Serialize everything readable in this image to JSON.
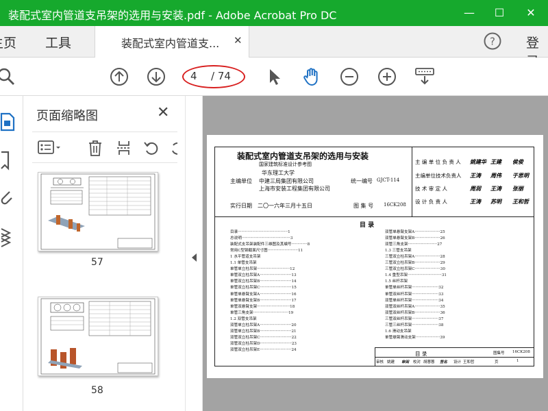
{
  "window": {
    "title": "装配式室内管道支吊架的选用与安装.pdf - Adobe Acrobat Pro DC",
    "minimize_glyph": "—",
    "maximize_glyph": "☐",
    "close_glyph": "✕"
  },
  "tabs": {
    "home": "主页",
    "tools": "工具",
    "document": "装配式室内管道支...",
    "close_glyph": "✕",
    "login": "登录"
  },
  "toolbar": {
    "current_page": "4",
    "total_pages": "/ 74",
    "accent_color": "#1e71c4",
    "icons": [
      "search-icon",
      "page-up-icon",
      "page-down-icon",
      "select-cursor-icon",
      "hand-tool-icon",
      "zoom-out-icon",
      "zoom-in-icon",
      "keyboard-nav-icon"
    ]
  },
  "thumbnail_panel": {
    "title": "页面缩略图",
    "close_glyph": "✕",
    "thumbnails": [
      {
        "label": "57"
      },
      {
        "label": "58"
      }
    ]
  },
  "document": {
    "cover": {
      "title": "装配式室内管道支吊架的选用与安装",
      "subtitle": "国家建筑标准设计参考图",
      "org_first": "华东理工大学",
      "main_unit_label": "主编单位",
      "main_unit_2": "中建三局集团有限公司",
      "main_unit_3": "上海市安装工程集团有限公司",
      "serial_label": "统一编号",
      "serial_no": "GJCT-114",
      "effective_label": "实行日期",
      "effective_date": "二〇一六年三月十五日",
      "atlas_label": "图 集 号",
      "atlas_no": "16CK208",
      "sign_rows": [
        {
          "role": "主 编 单 位 负 责 人",
          "sig1": "姚建华",
          "sig2": "王建",
          "sig3": "侯俊"
        },
        {
          "role": "主编单位技术负责人",
          "sig1": "王涛",
          "sig2": "周伟",
          "sig3": "于思明"
        },
        {
          "role": "技 术 审 定 人",
          "sig1": "周润",
          "sig2": "王涛",
          "sig3": "张丽"
        },
        {
          "role": "设 计 负 责 人",
          "sig1": "王涛",
          "sig2": "苏明",
          "sig3": "王和哲"
        }
      ]
    },
    "toc_title": "目 录",
    "toc_left": [
      "目录·········································1",
      "总说明········································3",
      "装配式支吊架装配件三维图及其编号·············8",
      "常用C型钢截面尺寸图·························11",
      "1   水平管道支吊架",
      "  1.1  单管支吊架",
      "       单管单立柱吊架···························12",
      "       单管双立柱吊架A··························13",
      "       单管双立柱吊架B··························14",
      "       单管双立柱吊架C··························15",
      "       单管单悬臂支架A··························16",
      "       单管单悬臂支架B··························17",
      "       单管双悬臂支架···························18",
      "       单管三角支架·····························19",
      "  1.2  双管支吊架",
      "       双管单立柱吊架A··························20",
      "       双管单立柱吊架B··························21",
      "       双管双立柱吊架C··························22",
      "       双管双立柱吊架D··························23",
      "       双管双立柱吊架E··························24"
    ],
    "toc_right": [
      "       双管单悬臂支架A·····················25",
      "       双管单悬臂支架B·····················26",
      "       双管三角支架························27",
      "  1.3  三管支吊架",
      "       三管双立柱吊架A·····················28",
      "       三管双立柱吊架B·····················29",
      "       三管双立柱吊架C·····················30",
      "  1.4  重型吊架····························31",
      "  1.5  丝杆吊架",
      "       单管单丝杆吊架······················32",
      "       单管双丝杆吊架······················33",
      "       双管单丝杆吊架······················34",
      "       双管双丝杆吊架A·····················35",
      "       双管双丝杆吊架B·····················36",
      "       三管双丝杆吊架······················37",
      "       三管三丝杆吊架······················38",
      "  1.6  滑动支吊架",
      "       单管悬臂滑动支架····················39"
    ],
    "footer": {
      "caption": "目  录",
      "atlas_label": "图集号",
      "atlas_no": "16CK208",
      "row": [
        "审核",
        "姚建",
        "审阅",
        "校对",
        "胡蓉蓉",
        "签名",
        "设计",
        "王和哲",
        "页",
        "1"
      ]
    }
  }
}
